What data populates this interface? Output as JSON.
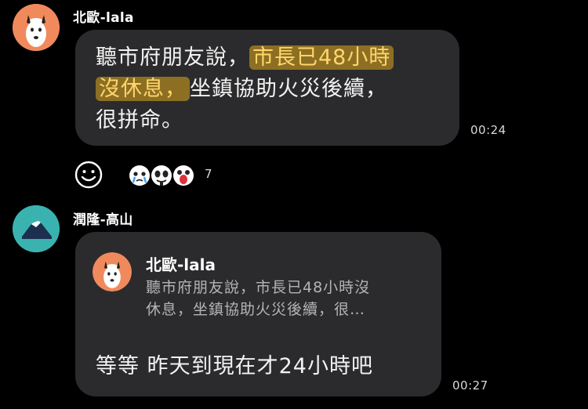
{
  "messages": [
    {
      "sender": "北歐-lala",
      "text_lines": [
        {
          "plain": "聽市府朋友說，",
          "highlight": "市長已48小時"
        },
        {
          "highlight": "沒休息，",
          "plain": "坐鎮協助火災後續，"
        },
        {
          "plain": "很拼命。"
        }
      ],
      "time": "00:24"
    },
    {
      "sender": "潤隆-高山",
      "reply": {
        "name": "北歐-lala",
        "line1": "聽市府朋友說，市長已48小時沒",
        "line2": "休息，坐鎮協助火災後續，很…"
      },
      "text": "等等 昨天到現在才24小時吧",
      "time": "00:27"
    }
  ],
  "reactions": {
    "count": "7",
    "icons": [
      "add-reaction-smiley-icon",
      "crying-sticker-icon",
      "panda-sticker-icon",
      "shocked-sticker-icon"
    ]
  },
  "colors": {
    "background": "#000000",
    "bubble": "#2b2b2d",
    "highlight": "#dea81e",
    "avatar_dog_bg": "#f08a5d",
    "avatar_mountain_bg": "#3ab3b0"
  }
}
